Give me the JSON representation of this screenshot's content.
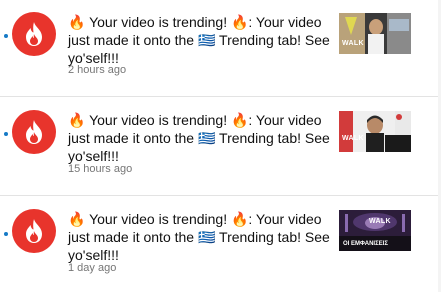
{
  "notifications": [
    {
      "message": "🔥 Your video is trending! 🔥: Your video just made it onto the 🇬🇷 Trending tab! See yo'self!!!",
      "time": "2 hours ago",
      "thumb": {
        "overlay_text": "WALK",
        "caption": ""
      }
    },
    {
      "message": "🔥 Your video is trending! 🔥: Your video just made it onto the 🇬🇷 Trending tab! See yo'self!!!",
      "time": "15 hours ago",
      "thumb": {
        "overlay_text": "WALK",
        "caption": ""
      }
    },
    {
      "message": "🔥 Your video is trending! 🔥: Your video just made it onto the 🇬🇷 Trending tab! See yo'self!!!",
      "time": "1 day ago",
      "thumb": {
        "overlay_text": "WALK",
        "caption": "ΟΙ ΕΜΦΑΝΙΣΕΙΣ"
      }
    }
  ],
  "colors": {
    "avatar_bg": "#e8342c",
    "unread_dot": "#167ac6",
    "timestamp": "#767676",
    "divider": "#e3e3e3"
  },
  "icons": {
    "avatar": "flame-icon",
    "unread": "unread-dot-icon"
  }
}
